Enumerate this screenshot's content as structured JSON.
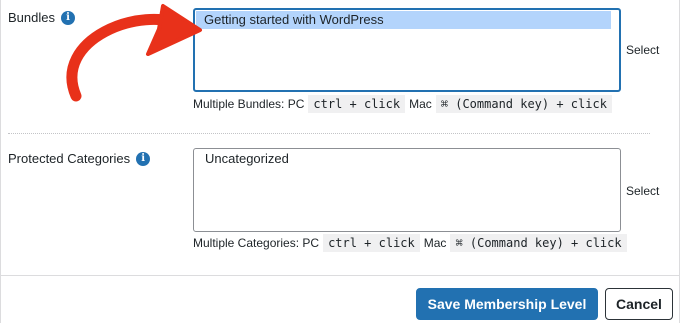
{
  "bundles": {
    "label": "Bundles",
    "options": [
      "Getting started with WordPress"
    ],
    "selected_option": "Getting started with WordPress",
    "select_link": "Select",
    "help": {
      "prefix": "Multiple Bundles: PC",
      "pc_keys": "ctrl + click",
      "mac_label": "Mac",
      "mac_keys": "⌘ (Command key) + click"
    }
  },
  "protected_categories": {
    "label": "Protected Categories",
    "options": [
      "Uncategorized"
    ],
    "select_link": "Select",
    "help": {
      "prefix": "Multiple Categories: PC",
      "pc_keys": "ctrl + click",
      "mac_label": "Mac",
      "mac_keys": "⌘ (Command key) + click"
    }
  },
  "footer": {
    "save_label": "Save Membership Level",
    "cancel_label": "Cancel"
  },
  "icons": {
    "info": "info-icon",
    "annotation": "curved-arrow-icon"
  },
  "colors": {
    "accent": "#2271b1",
    "arrow": "#e8311a",
    "selection": "#b3d4fc"
  }
}
